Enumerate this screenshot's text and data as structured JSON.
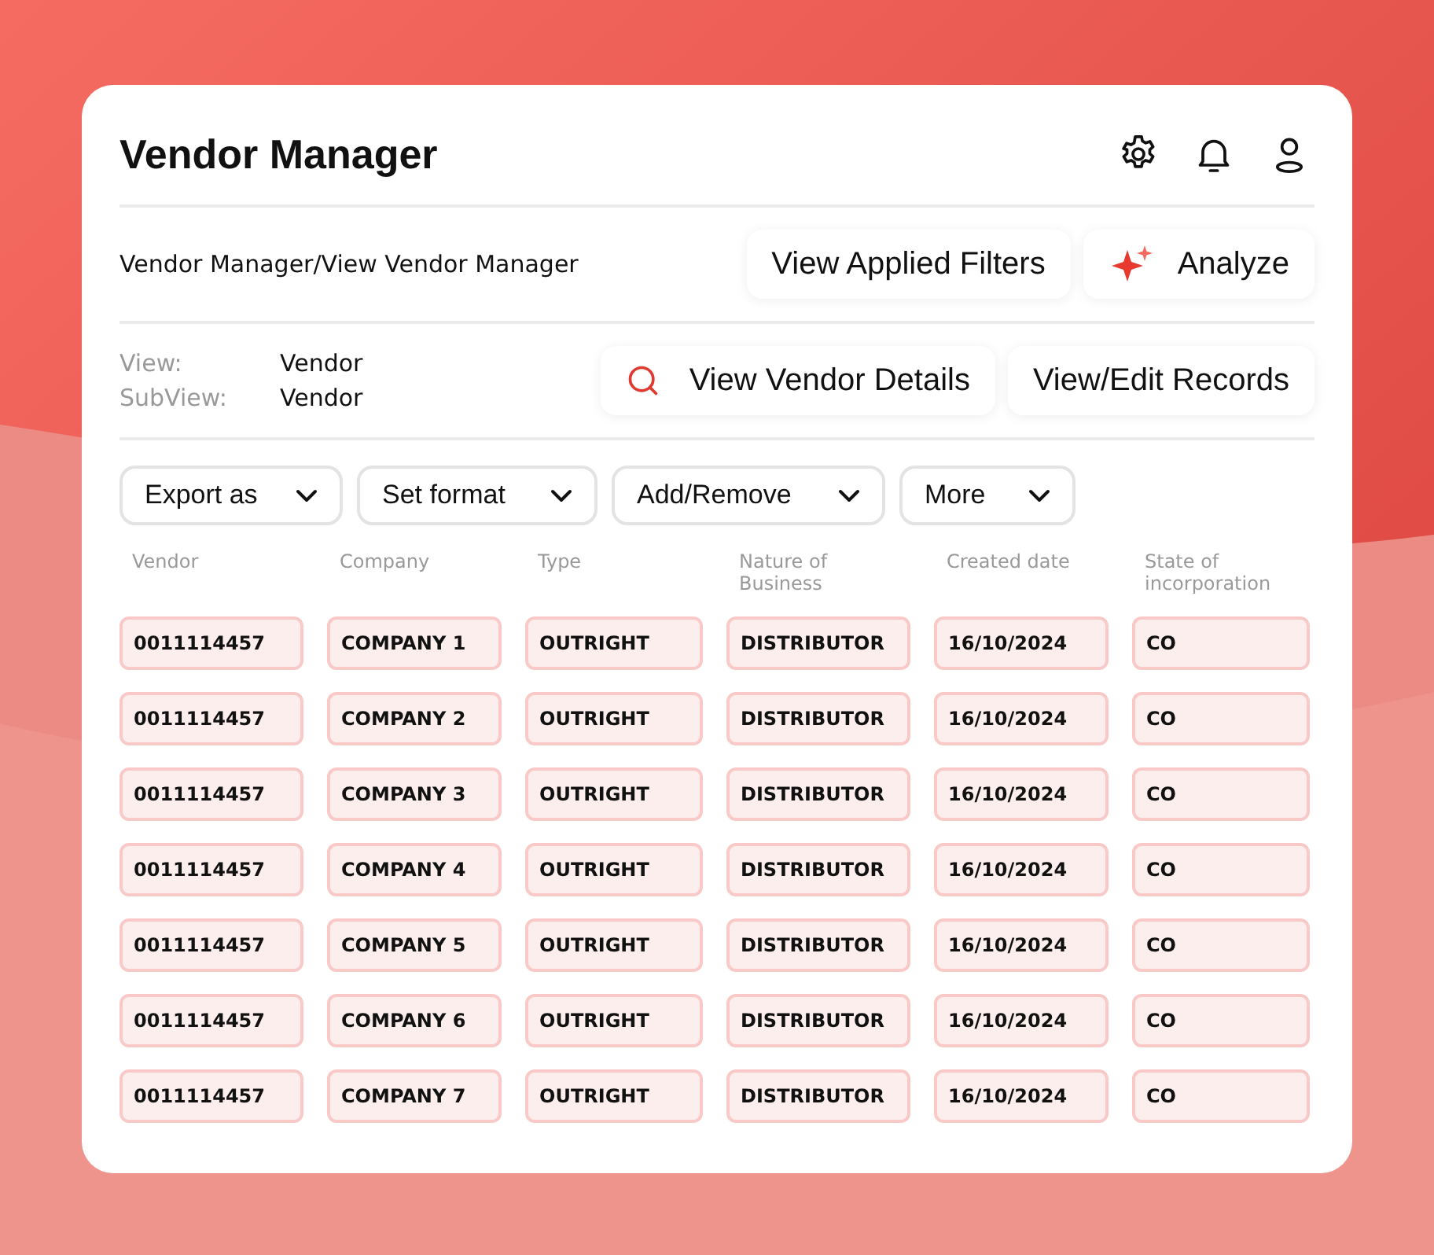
{
  "header": {
    "title": "Vendor Manager"
  },
  "breadcrumb": "Vendor Manager/View Vendor Manager",
  "actions": [
    {
      "label": "View Applied Filters",
      "kind": "plain"
    },
    {
      "label": "Analyze",
      "kind": "sparkle"
    }
  ],
  "view_info": [
    {
      "label": "View:",
      "value": "Vendor"
    },
    {
      "label": "SubView:",
      "value": "Vendor"
    }
  ],
  "view_actions": [
    {
      "label": "View Vendor Details",
      "kind": "search"
    },
    {
      "label": "View/Edit Records",
      "kind": "plain"
    }
  ],
  "dropdowns": [
    "Export as",
    "Set format",
    "Add/Remove",
    "More"
  ],
  "table": {
    "columns": [
      "Vendor",
      "Company",
      "Type",
      "Nature of Business",
      "Created date",
      "State of incorporation"
    ],
    "rows": [
      [
        "0011114457",
        "COMPANY 1",
        "OUTRIGHT",
        "DISTRIBUTOR",
        "16/10/2024",
        "CO"
      ],
      [
        "0011114457",
        "COMPANY 2",
        "OUTRIGHT",
        "DISTRIBUTOR",
        "16/10/2024",
        "CO"
      ],
      [
        "0011114457",
        "COMPANY 3",
        "OUTRIGHT",
        "DISTRIBUTOR",
        "16/10/2024",
        "CO"
      ],
      [
        "0011114457",
        "COMPANY 4",
        "OUTRIGHT",
        "DISTRIBUTOR",
        "16/10/2024",
        "CO"
      ],
      [
        "0011114457",
        "COMPANY 5",
        "OUTRIGHT",
        "DISTRIBUTOR",
        "16/10/2024",
        "CO"
      ],
      [
        "0011114457",
        "COMPANY 6",
        "OUTRIGHT",
        "DISTRIBUTOR",
        "16/10/2024",
        "CO"
      ],
      [
        "0011114457",
        "COMPANY 7",
        "OUTRIGHT",
        "DISTRIBUTOR",
        "16/10/2024",
        "CO"
      ]
    ]
  }
}
